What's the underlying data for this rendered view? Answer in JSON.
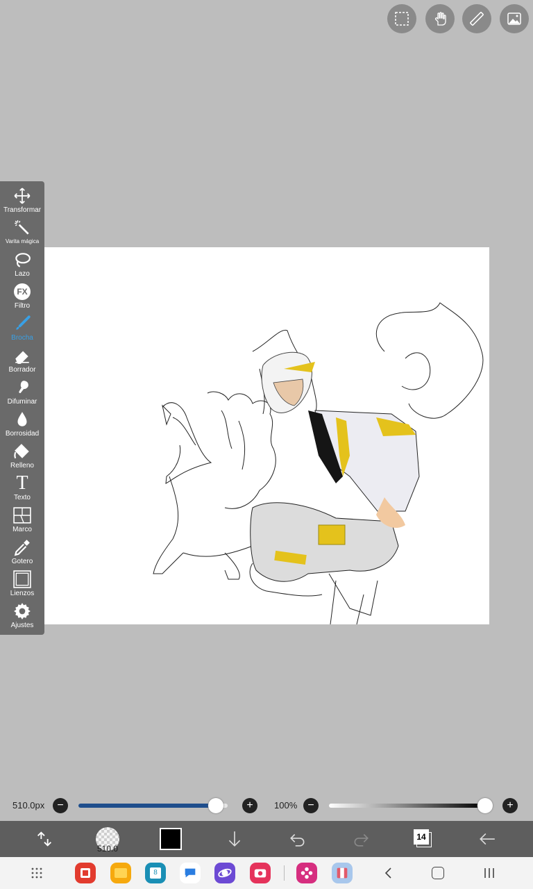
{
  "tools": [
    {
      "name": "transformar",
      "label": "Transformar"
    },
    {
      "name": "varita",
      "label": "Varita mágica"
    },
    {
      "name": "lazo",
      "label": "Lazo"
    },
    {
      "name": "filtro",
      "label": "Filtro"
    },
    {
      "name": "brocha",
      "label": "Brocha"
    },
    {
      "name": "borrador",
      "label": "Borrador"
    },
    {
      "name": "difuminar",
      "label": "Difuminar"
    },
    {
      "name": "borrosidad",
      "label": "Borrosidad"
    },
    {
      "name": "relleno",
      "label": "Relleno"
    },
    {
      "name": "texto",
      "label": "Texto"
    },
    {
      "name": "marco",
      "label": "Marco"
    },
    {
      "name": "gotero",
      "label": "Gotero"
    },
    {
      "name": "lienzos",
      "label": "Lienzos"
    },
    {
      "name": "ajustes",
      "label": "Ajustes"
    }
  ],
  "active_tool": "Brocha",
  "fx_icon_text": "FX",
  "text_icon_text": "T",
  "brush": {
    "size_label": "510.0px",
    "size_level": 0.92,
    "badge": "510.0"
  },
  "opacity": {
    "label": "100%",
    "level": 1.0
  },
  "layers_count": "14",
  "colors": {
    "active": "#39a0e5",
    "size_fill": "#1f4e8c",
    "current_color": "#000000"
  }
}
